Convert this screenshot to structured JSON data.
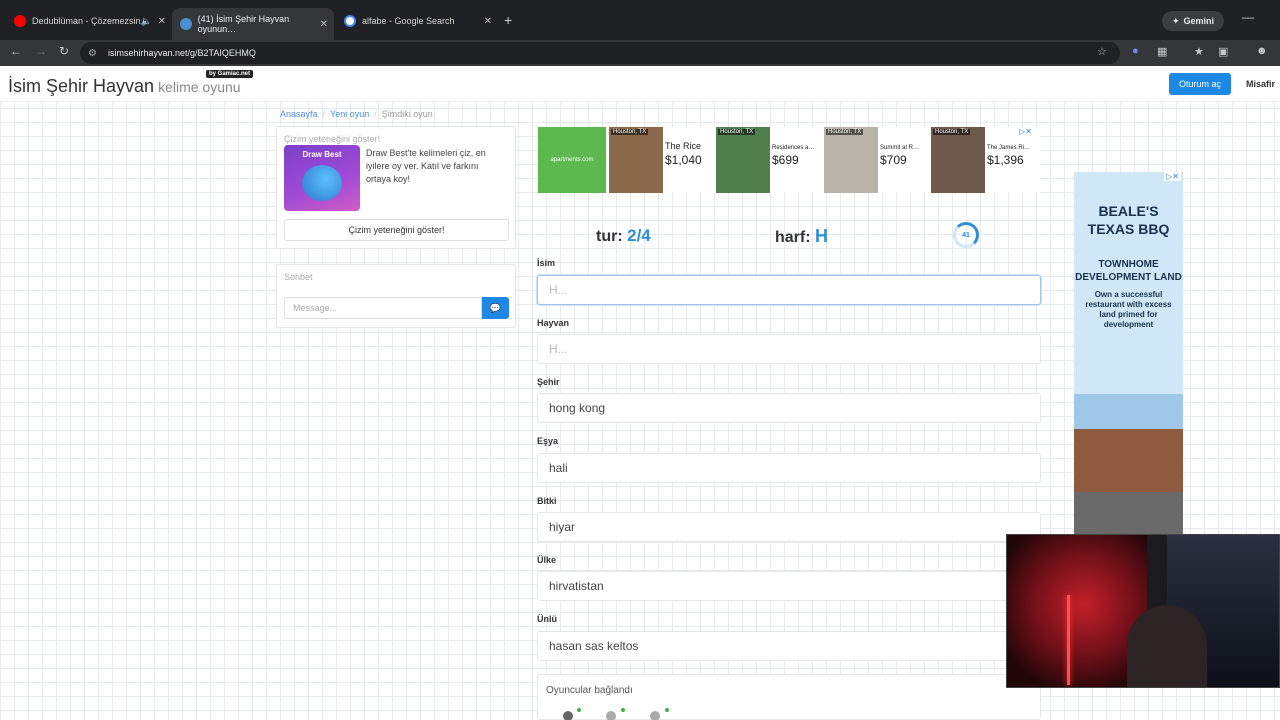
{
  "browser": {
    "tabs": [
      {
        "label": "Dedublüman - Çözemezsin",
        "favicon_color": "#ff0000",
        "audio": true
      },
      {
        "label": "(41) İsim Şehir Hayvan oyunun…",
        "favicon_color": "#4a8fd6",
        "active": true
      },
      {
        "label": "alfabe - Google Search",
        "favicon_color": "#ffffff"
      }
    ],
    "new_tab": "+",
    "gemini_label": "Gemini",
    "url": "isimsehirhayvan.net/g/B2TAIQEHMQ"
  },
  "header": {
    "brand": "İsim Şehir Hayvan",
    "brand_sub": "kelime oyunu",
    "byline": "by Gamiac.net",
    "login": "Oturum aç",
    "guest": "Misafir"
  },
  "breadcrumb": {
    "home": "Anasayfa",
    "new_game": "Yeni oyun",
    "current": "Şimdiki oyun"
  },
  "promo": {
    "title": "Çizim yeteneğini göster!",
    "image_label": "Draw Best",
    "text": "Draw Best'te kelimeleri çiz, en iyilere oy ver. Katıl ve farkını ortaya koy!",
    "button": "Çizim yeteneğini göster!"
  },
  "chat": {
    "title": "Sohbet",
    "placeholder": "Message..."
  },
  "ad_top": {
    "logo": "apartments.com",
    "cards": [
      {
        "location": "Houston, TX",
        "name": "The Rice",
        "price": "$1,040",
        "photo_color": "#8a6a4a"
      },
      {
        "location": "Houston, TX",
        "name": "Residences a…",
        "price": "$699",
        "photo_color": "#4f7f4a"
      },
      {
        "location": "Houston, TX",
        "name": "Summit at R…",
        "price": "$709",
        "photo_color": "#b9b4aa"
      },
      {
        "location": "Houston, TX",
        "name": "The James Ri…",
        "price": "$1,396",
        "photo_color": "#6d5a4c"
      }
    ]
  },
  "game": {
    "round_label": "tur:",
    "round_value": "2/4",
    "letter_label": "harf:",
    "letter_value": "H",
    "timer": "41",
    "accent_color": "#2e8fd6",
    "fields": [
      {
        "label": "İsim",
        "value": "",
        "placeholder": "H..."
      },
      {
        "label": "Hayvan",
        "value": "",
        "placeholder": "H..."
      },
      {
        "label": "Şehir",
        "value": "hong kong",
        "placeholder": ""
      },
      {
        "label": "Eşya",
        "value": "hali",
        "placeholder": ""
      },
      {
        "label": "Bitki",
        "value": "hiyar",
        "placeholder": ""
      },
      {
        "label": "Ülke",
        "value": "hirvatistan",
        "placeholder": ""
      },
      {
        "label": "Ünlü",
        "value": "hasan sas keltos",
        "placeholder": ""
      }
    ],
    "players_status": "Oyuncular bağlandı"
  },
  "ad_side": {
    "headline": "BEALE'S TEXAS BBQ",
    "sub1": "TOWNHOME DEVELOPMENT LAND",
    "sub2": "Own a successful restaurant with excess land primed for development"
  }
}
